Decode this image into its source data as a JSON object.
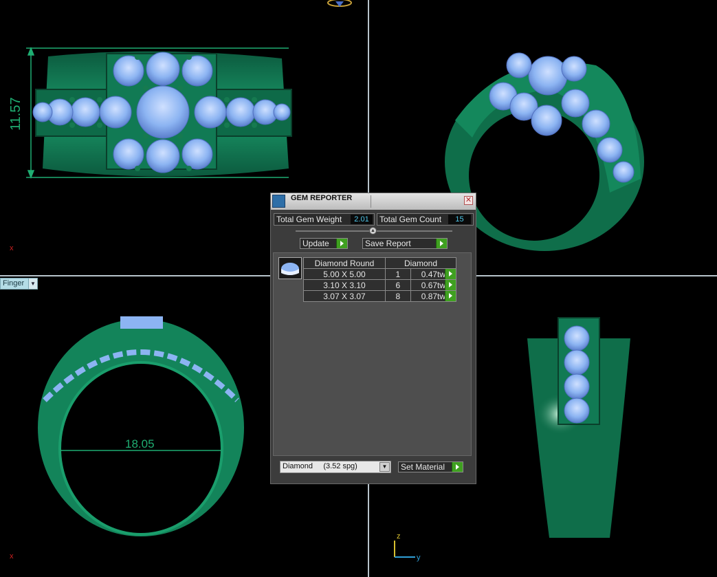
{
  "viewports": {
    "dims": {
      "height_dim": "11.57",
      "ring_size_dim": "18.05"
    },
    "axis_labels": {
      "x_top": "x",
      "x_bottom": "x",
      "z": "z",
      "y": "y"
    }
  },
  "finger_dropdown": {
    "label": "Finger"
  },
  "gem_reporter": {
    "title": "GEM REPORTER",
    "close_glyph": "✕",
    "total_gem_weight_label": "Total Gem Weight",
    "total_gem_weight_value": "2.01",
    "total_gem_count_label": "Total Gem Count",
    "total_gem_count_value": "15",
    "update_label": "Update",
    "save_report_label": "Save Report",
    "table": {
      "headers": [
        "Diamond Round",
        "Diamond"
      ],
      "rows": [
        {
          "size": "5.00 X 5.00",
          "count": "1",
          "weight": "0.47tw"
        },
        {
          "size": "3.10 X 3.10",
          "count": "6",
          "weight": "0.67tw"
        },
        {
          "size": "3.07 X 3.07",
          "count": "8",
          "weight": "0.87tw"
        }
      ]
    },
    "material_select": {
      "name": "Diamond",
      "spg": "(3.52 spg)"
    },
    "set_material_label": "Set Material"
  },
  "colors": {
    "metal": "#14805a",
    "gem": "#8cb4f2",
    "background": "#000000",
    "go_green": "#3fa020"
  }
}
